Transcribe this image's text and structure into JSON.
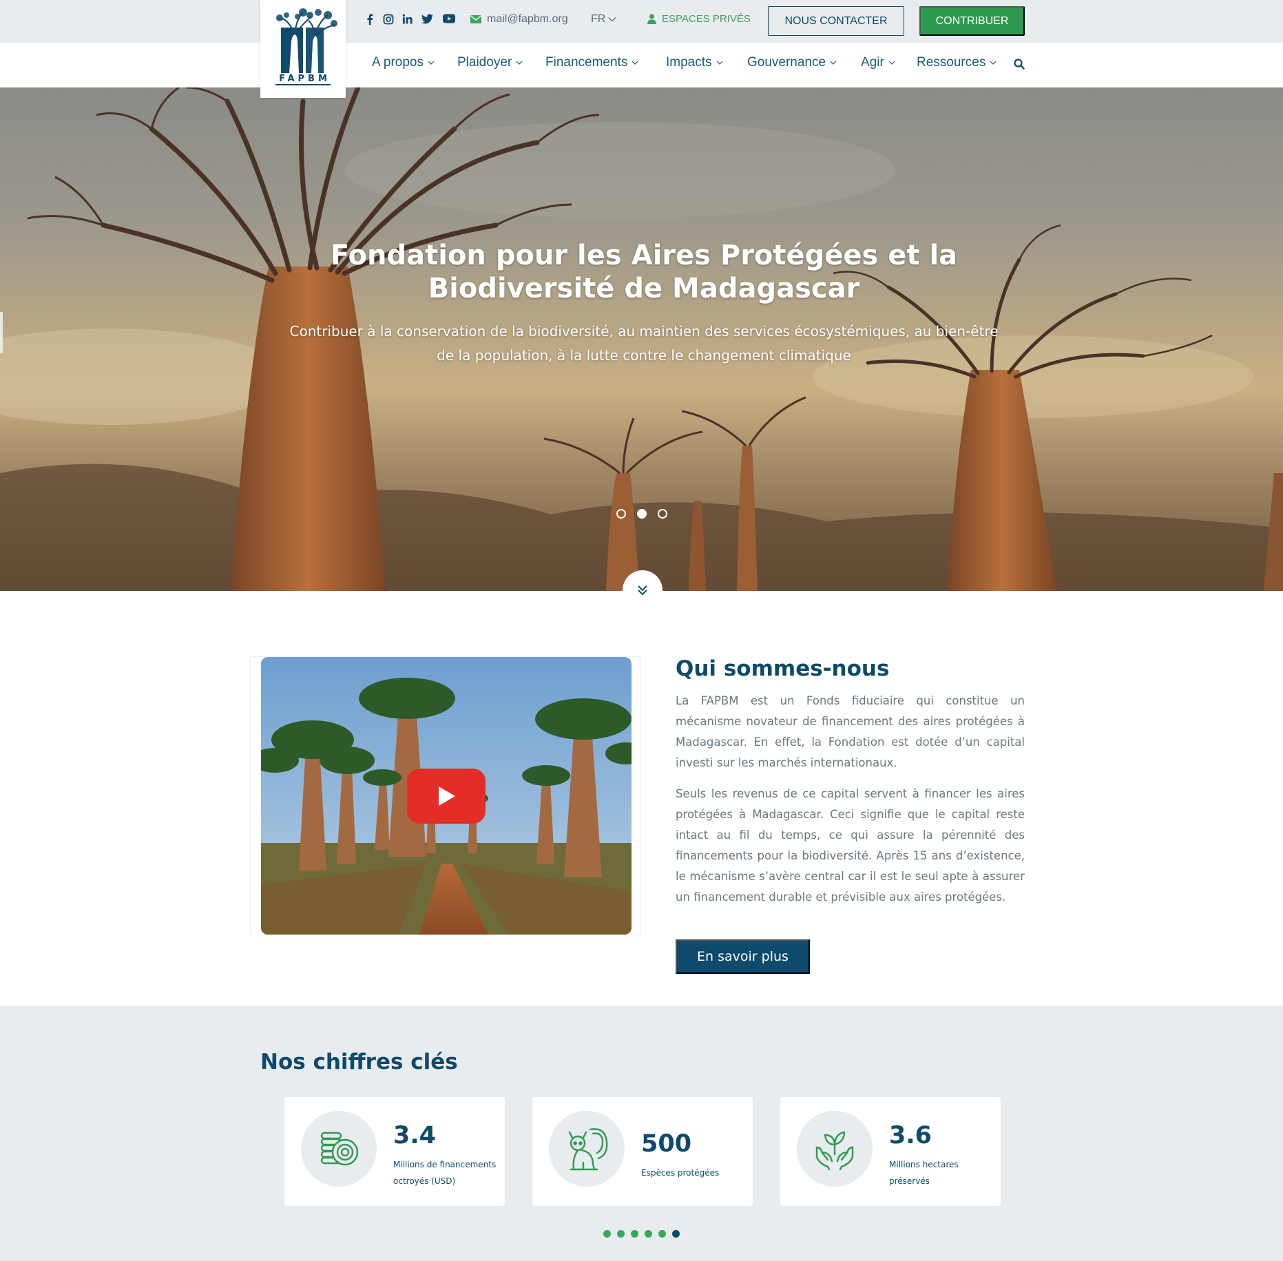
{
  "header": {
    "logo_text": "FAPBM",
    "social": [
      "facebook-icon",
      "instagram-icon",
      "linkedin-icon",
      "twitter-icon",
      "youtube-icon"
    ],
    "email": "mail@fapbm.org",
    "language": "FR",
    "private_spaces": "ESPACES PRIVÉS",
    "contact_button": "NOUS CONTACTER",
    "contribute_button": "CONTRIBUER"
  },
  "nav": {
    "items": [
      {
        "label": "A propos"
      },
      {
        "label": "Plaidoyer"
      },
      {
        "label": "Financements"
      },
      {
        "label": "Impacts"
      },
      {
        "label": "Gouvernance"
      },
      {
        "label": "Agir"
      },
      {
        "label": "Ressources"
      }
    ]
  },
  "hero": {
    "title": "Fondation pour les Aires Protégées et la Biodiversité de Madagascar",
    "subtitle": "Contribuer à la conservation de la biodiversité, au maintien des services écosystémiques, au bien-être de la population, à la lutte contre le changement climatique",
    "slides": 3,
    "active_slide": 2
  },
  "about": {
    "title": "Qui sommes-nous",
    "paragraph1": "La FAPBM est un Fonds fiduciaire qui constitue un mécanisme novateur de financement des aires protégées à Madagascar. En effet, la Fondation est dotée d’un capital investi sur les marchés internationaux.",
    "paragraph2": "Seuls les revenus de ce capital servent à financer les aires protégées à Madagascar. Ceci signifie que le capital reste intact au fil du temps, ce qui assure la pérennité des financements pour la biodiversité. Après 15 ans d’existence, le mécanisme s’avère central car il est le seul apte à assurer un financement durable et prévisible aux aires protégées.",
    "button": "En savoir plus"
  },
  "stats": {
    "title": "Nos chiffres clés",
    "cards": [
      {
        "value": "3.4",
        "label": "Millions de financements octroyés (USD)",
        "icon": "coins-icon"
      },
      {
        "value": "500",
        "label": "Espèces protégées",
        "icon": "lemur-icon"
      },
      {
        "value": "3.6",
        "label": "Millions hectares préservés",
        "icon": "hands-plant-icon"
      }
    ],
    "pages": 6,
    "active_page": 6
  },
  "colors": {
    "primary": "#0d4a6b",
    "accent": "#2e9a4f",
    "topbar_bg": "#e8ecef"
  }
}
